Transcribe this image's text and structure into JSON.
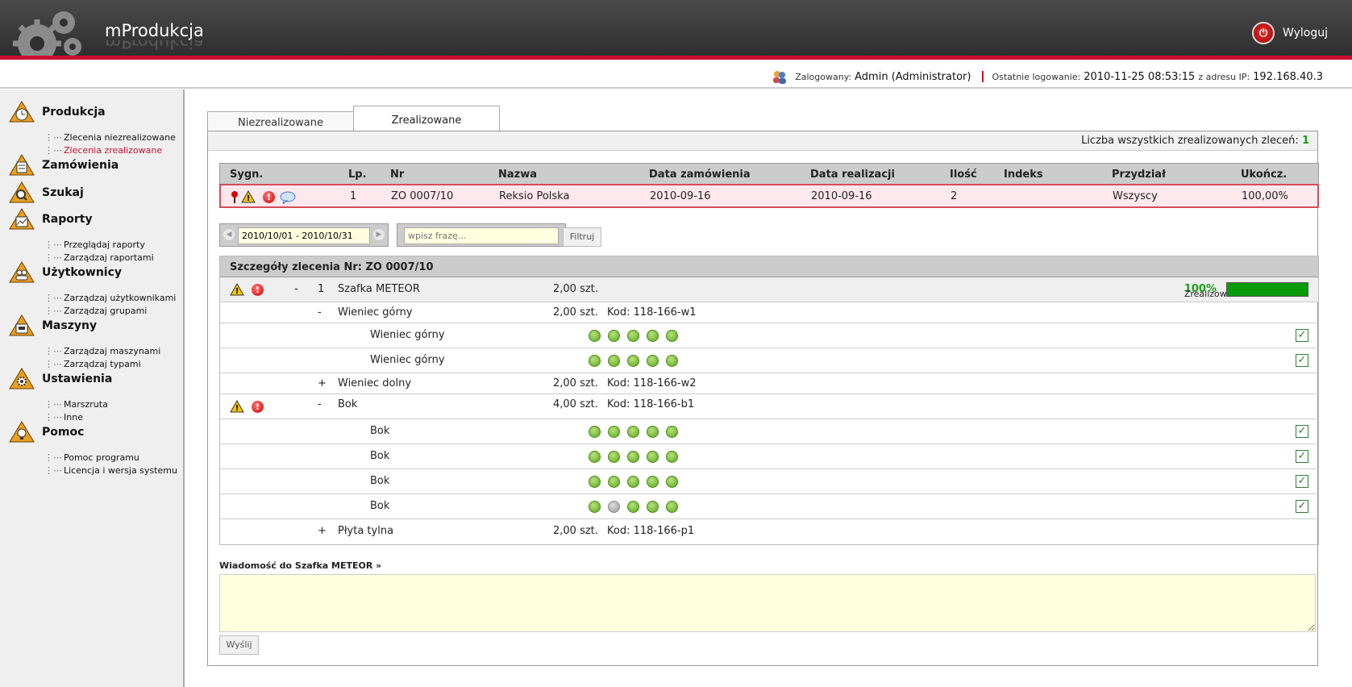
{
  "app": {
    "title": "mProdukcja",
    "logout": "Wyloguj"
  },
  "login": {
    "logged_label": "Zalogowany:",
    "user": "Admin (Administrator)",
    "last_label": "Ostatnie logowanie:",
    "last_time": "2010-11-25 08:53:15",
    "ip_label": "z adresu IP:",
    "ip": "192.168.40.3"
  },
  "sidebar": {
    "sections": [
      {
        "label": "Produkcja",
        "icon": "clock-icon",
        "items": [
          "Zlecenia niezrealizowane",
          "Zlecenia zrealizowane"
        ]
      },
      {
        "label": "Zamówienia",
        "icon": "document-icon",
        "items": []
      },
      {
        "label": "Szukaj",
        "icon": "magnifier-icon",
        "items": []
      },
      {
        "label": "Raporty",
        "icon": "chart-icon",
        "items": [
          "Przeglądaj raporty",
          "Zarządzaj raportami"
        ]
      },
      {
        "label": "Użytkownicy",
        "icon": "users-icon",
        "items": [
          "Zarządzaj użytkownikami",
          "Zarządzaj grupami"
        ]
      },
      {
        "label": "Maszyny",
        "icon": "machine-icon",
        "items": [
          "Zarządzaj maszynami",
          "Zarządzaj typami"
        ]
      },
      {
        "label": "Ustawienia",
        "icon": "gear-icon",
        "items": [
          "Marszruta",
          "Inne"
        ]
      },
      {
        "label": "Pomoc",
        "icon": "bulb-icon",
        "items": [
          "Pomoc programu",
          "Licencja i wersja systemu"
        ]
      }
    ],
    "active_item": "Zlecenia zrealizowane"
  },
  "tabs": {
    "t1": "Niezrealizowane",
    "t2": "Zrealizowane"
  },
  "count": {
    "label": "Liczba wszystkich zrealizowanych zleceń:",
    "value": "1"
  },
  "orders": {
    "headers": [
      "Sygn.",
      "Lp.",
      "Nr",
      "Nazwa",
      "Data zamówienia",
      "Data realizacji",
      "Ilość",
      "Indeks",
      "Przydział",
      "Ukończ."
    ],
    "row": {
      "lp": "1",
      "nr": "ZO 0007/10",
      "nazwa": "Reksio Polska",
      "data_zam": "2010-09-16",
      "data_real": "2010-09-16",
      "ilosc": "2",
      "indeks": "",
      "przydzial": "Wszyscy",
      "ukoncz": "100,00%"
    }
  },
  "filters": {
    "date_range": "2010/10/01 - 2010/10/31",
    "phrase_placeholder": "wpisz frazę...",
    "filter_btn": "Filtruj"
  },
  "details": {
    "title": "Szczegóły zlecenia Nr: ZO 0007/10",
    "main": {
      "toggle": "-",
      "lp": "1",
      "name": "Szafka METEOR",
      "qty": "2,00 szt.",
      "realized_label": "Zrealizowano:",
      "realized_value": "100%",
      "progress": 1.0
    },
    "wg": {
      "toggle": "-",
      "name": "Wieniec górny",
      "qty": "2,00 szt.",
      "code": "Kod: 118-166-w1",
      "sub1": "Wieniec górny",
      "sub2": "Wieniec górny"
    },
    "wd": {
      "toggle": "+",
      "name": "Wieniec dolny",
      "qty": "2,00 szt.",
      "code": "Kod: 118-166-w2"
    },
    "bok": {
      "toggle": "-",
      "name": "Bok",
      "qty": "4,00 szt.",
      "code": "Kod: 118-166-b1",
      "sub1": "Bok",
      "sub2": "Bok",
      "sub3": "Bok",
      "sub4": "Bok"
    },
    "pt": {
      "toggle": "+",
      "name": "Płyta tylna",
      "qty": "2,00 szt.",
      "code": "Kod: 118-166-p1"
    }
  },
  "message": {
    "label": "Wiadomość do Szafka METEOR »",
    "send": "Wyślij"
  }
}
